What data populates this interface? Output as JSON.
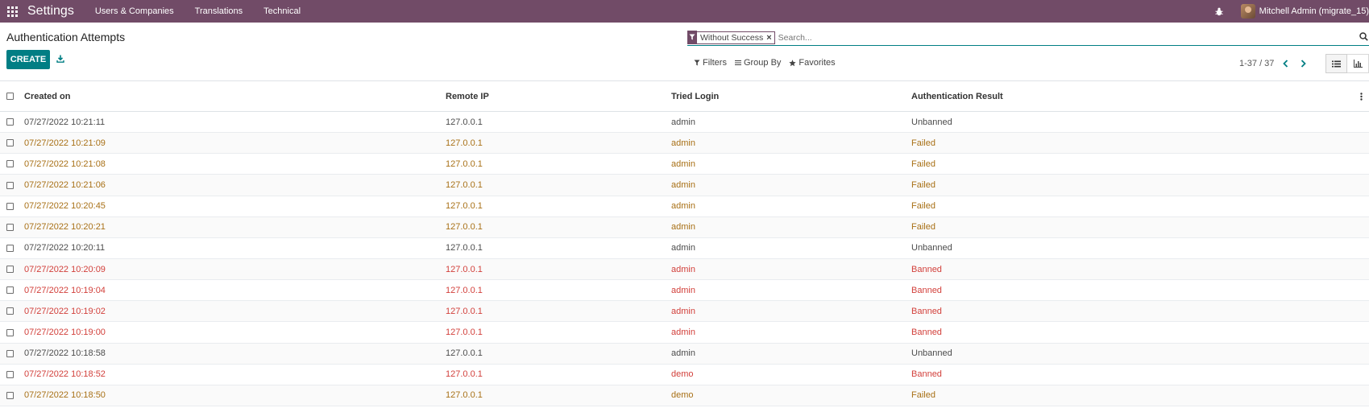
{
  "navbar": {
    "app_title": "Settings",
    "menu": [
      "Users & Companies",
      "Translations",
      "Technical"
    ],
    "user_name": "Mitchell Admin (migrate_15)"
  },
  "control_panel": {
    "title": "Authentication Attempts",
    "create_label": "CREATE",
    "search": {
      "facet_value": "Without Success",
      "placeholder": "Search..."
    },
    "filters_label": "Filters",
    "group_by_label": "Group By",
    "favorites_label": "Favorites",
    "pager": "1-37 / 37"
  },
  "table": {
    "columns": [
      "Created on",
      "Remote IP",
      "Tried Login",
      "Authentication Result"
    ],
    "rows": [
      {
        "created": "07/27/2022 10:21:11",
        "ip": "127.0.0.1",
        "login": "admin",
        "result": "Unbanned",
        "status": "normal"
      },
      {
        "created": "07/27/2022 10:21:09",
        "ip": "127.0.0.1",
        "login": "admin",
        "result": "Failed",
        "status": "warning"
      },
      {
        "created": "07/27/2022 10:21:08",
        "ip": "127.0.0.1",
        "login": "admin",
        "result": "Failed",
        "status": "warning"
      },
      {
        "created": "07/27/2022 10:21:06",
        "ip": "127.0.0.1",
        "login": "admin",
        "result": "Failed",
        "status": "warning"
      },
      {
        "created": "07/27/2022 10:20:45",
        "ip": "127.0.0.1",
        "login": "admin",
        "result": "Failed",
        "status": "warning"
      },
      {
        "created": "07/27/2022 10:20:21",
        "ip": "127.0.0.1",
        "login": "admin",
        "result": "Failed",
        "status": "warning"
      },
      {
        "created": "07/27/2022 10:20:11",
        "ip": "127.0.0.1",
        "login": "admin",
        "result": "Unbanned",
        "status": "normal"
      },
      {
        "created": "07/27/2022 10:20:09",
        "ip": "127.0.0.1",
        "login": "admin",
        "result": "Banned",
        "status": "danger"
      },
      {
        "created": "07/27/2022 10:19:04",
        "ip": "127.0.0.1",
        "login": "admin",
        "result": "Banned",
        "status": "danger"
      },
      {
        "created": "07/27/2022 10:19:02",
        "ip": "127.0.0.1",
        "login": "admin",
        "result": "Banned",
        "status": "danger"
      },
      {
        "created": "07/27/2022 10:19:00",
        "ip": "127.0.0.1",
        "login": "admin",
        "result": "Banned",
        "status": "danger"
      },
      {
        "created": "07/27/2022 10:18:58",
        "ip": "127.0.0.1",
        "login": "admin",
        "result": "Unbanned",
        "status": "normal"
      },
      {
        "created": "07/27/2022 10:18:52",
        "ip": "127.0.0.1",
        "login": "demo",
        "result": "Banned",
        "status": "danger"
      },
      {
        "created": "07/27/2022 10:18:50",
        "ip": "127.0.0.1",
        "login": "demo",
        "result": "Failed",
        "status": "warning"
      }
    ]
  },
  "colors": {
    "navbar": "#714b67",
    "primary": "#017e84",
    "warning_text": "#a87016",
    "danger_text": "#d23f3a"
  },
  "icons": [
    "apps-grid-icon",
    "bug-icon",
    "download-icon",
    "filter-icon",
    "remove-icon",
    "search-icon",
    "bars-icon",
    "star-icon",
    "chevron-left-icon",
    "chevron-right-icon",
    "list-view-icon",
    "graph-view-icon",
    "optional-columns-icon"
  ]
}
